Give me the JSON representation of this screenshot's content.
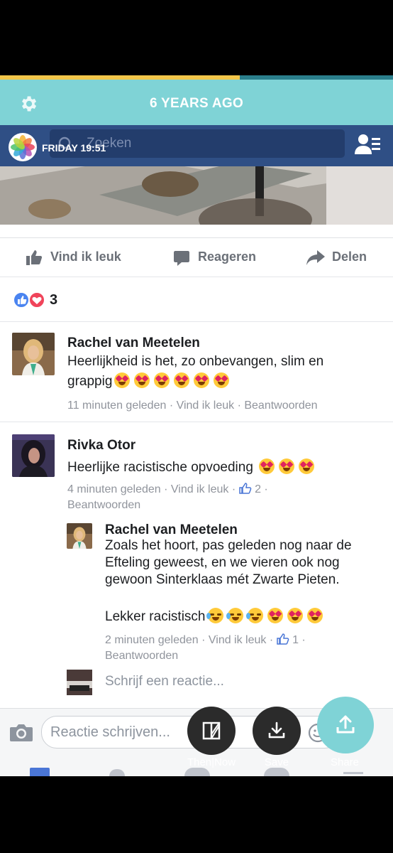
{
  "timehop": {
    "header_title": "6 YEARS AGO",
    "badge_text": "FRIDAY  19:51",
    "progress": 0.61,
    "buttons": {
      "then_now": "Then|Now",
      "save": "Save",
      "share": "Share"
    }
  },
  "facebook": {
    "search_placeholder": "Zoeken",
    "actions": {
      "like": "Vind ik leuk",
      "comment": "Reageren",
      "share": "Delen"
    },
    "reactions_count": "3",
    "comments": [
      {
        "name": "Rachel van Meetelen",
        "text_line1": "Heerlijkheid is het, zo onbevangen, slim en",
        "text_line2": "grappig",
        "time": "11 minuten geleden",
        "like": "Vind ik leuk",
        "reply": "Beantwoorden"
      },
      {
        "name": "Rivka Otor",
        "text": "Heerlijke racistische opvoeding",
        "time": "4 minuten geleden",
        "like": "Vind ik leuk",
        "like_count": "2",
        "reply": "Beantwoorden",
        "replies": [
          {
            "name": "Rachel van Meetelen",
            "text": "Zoals het hoort, pas geleden nog naar de Efteling geweest, en we vieren ook nog gewoon Sinterklaas mét Zwarte Pieten.",
            "text2": "Lekker racistisch",
            "time": "2 minuten geleden",
            "like": "Vind ik leuk",
            "like_count": "1",
            "reply": "Beantwoorden"
          }
        ]
      }
    ],
    "write_reply_placeholder": "Schrijf een reactie...",
    "comment_input_placeholder": "Reactie schrijven..."
  },
  "colors": {
    "timehop_header": "#7fd3d6",
    "facebook_blue": "#2f4f85",
    "progress_fill": "#f2c64a",
    "fab_dark": "#2b2b2b",
    "fab_share": "#7fd3d6"
  }
}
